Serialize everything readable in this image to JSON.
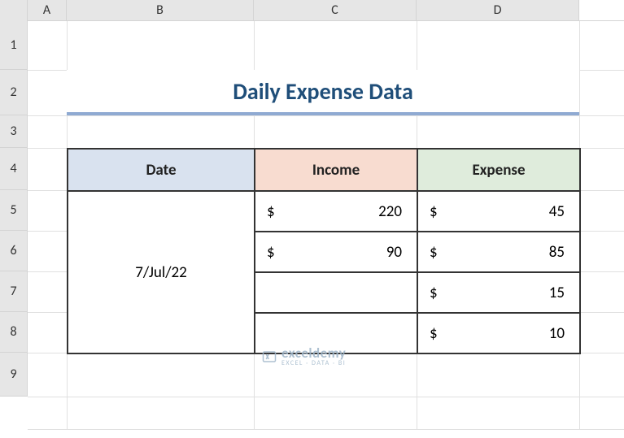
{
  "columns": {
    "labels": [
      "A",
      "B",
      "C",
      "D"
    ],
    "widths": [
      48,
      230,
      200,
      200
    ]
  },
  "rows": {
    "labels": [
      "1",
      "2",
      "3",
      "4",
      "5",
      "6",
      "7",
      "8",
      "9"
    ],
    "heights": [
      60,
      56,
      40,
      52,
      50,
      50,
      50,
      50,
      54
    ]
  },
  "title": "Daily Expense Data",
  "table": {
    "headers": {
      "date": "Date",
      "income": "Income",
      "expense": "Expense"
    },
    "date": "7/Jul/22",
    "currency_symbol": "$",
    "rows": [
      {
        "income": "220",
        "expense": "45"
      },
      {
        "income": "90",
        "expense": "85"
      },
      {
        "income": "",
        "expense": "15"
      },
      {
        "income": "",
        "expense": "10"
      }
    ]
  },
  "watermark": {
    "main": "exceldemy",
    "sub": "EXCEL · DATA · BI"
  }
}
